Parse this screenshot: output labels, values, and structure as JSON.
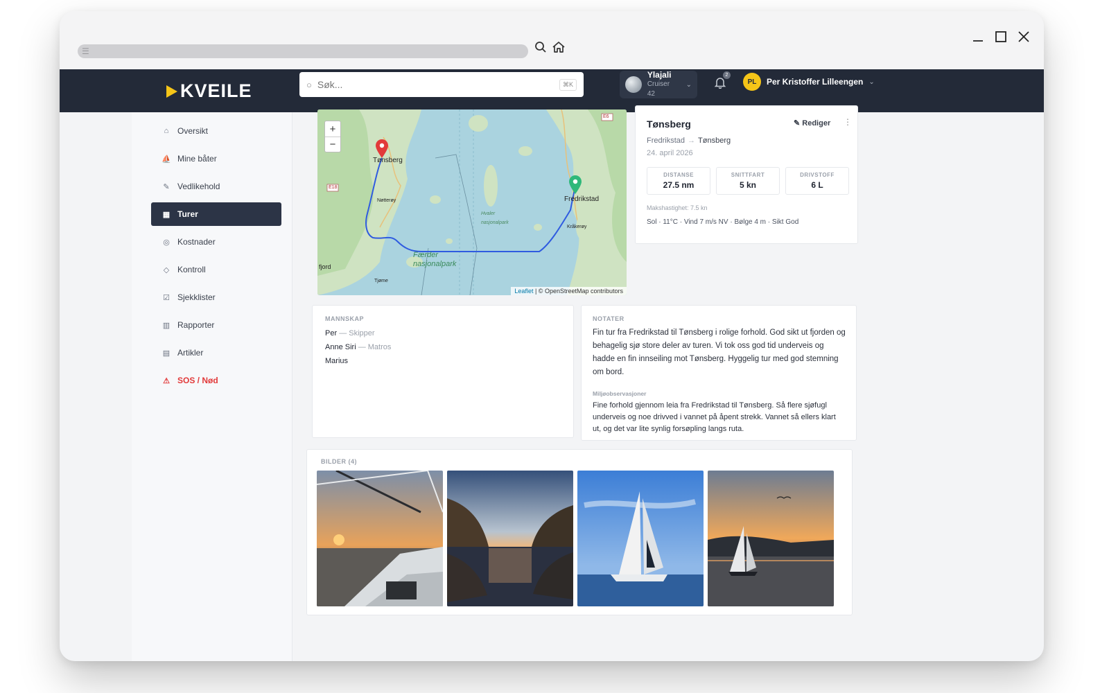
{
  "browser": {
    "window_controls": {
      "minimize_icon": "minimize-icon",
      "maximize_icon": "maximize-icon",
      "close_icon": "close-icon"
    },
    "toolbar_icons": [
      "search-icon",
      "home-icon"
    ]
  },
  "header": {
    "logo_text": "KVEILE",
    "search": {
      "placeholder": "Søk...",
      "shortcut": "⌘K"
    },
    "boat": {
      "name": "Ylajali",
      "model": "Cruiser 42"
    },
    "notifications": {
      "count": "2"
    },
    "user": {
      "initials": "PL",
      "name": "Per Kristoffer Lilleengen"
    }
  },
  "sidebar": {
    "items": [
      {
        "label": "Oversikt",
        "icon": "home-icon",
        "glyph": "⌂"
      },
      {
        "label": "Mine båter",
        "icon": "boat-icon",
        "glyph": "⛵"
      },
      {
        "label": "Vedlikehold",
        "icon": "wrench-icon",
        "glyph": "✎"
      },
      {
        "label": "Turer",
        "icon": "map-icon",
        "glyph": "▦"
      },
      {
        "label": "Kostnader",
        "icon": "coins-icon",
        "glyph": "◎"
      },
      {
        "label": "Kontroll",
        "icon": "shield-icon",
        "glyph": "◇"
      },
      {
        "label": "Sjekklister",
        "icon": "checklist-icon",
        "glyph": "☑"
      },
      {
        "label": "Rapporter",
        "icon": "bar-chart-icon",
        "glyph": "▥"
      },
      {
        "label": "Artikler",
        "icon": "article-icon",
        "glyph": "▤"
      },
      {
        "label": "SOS / Nød",
        "icon": "warning-icon",
        "glyph": "⚠"
      }
    ],
    "active_index": 3
  },
  "map": {
    "zoom_in": "+",
    "zoom_out": "−",
    "places": [
      "Tønsberg",
      "Fredrikstad",
      "Nøtterøy",
      "Kråkerøy",
      "fjord",
      "Tjøme",
      "E18",
      "E6"
    ],
    "park": "Færder nasjonalpark",
    "reserve": "Hvaler nasjonalpark",
    "attribution_link": "Leaflet",
    "attribution_text": "| © OpenStreetMap contributors"
  },
  "trip": {
    "title": "Tønsberg",
    "edit_label": "Rediger",
    "from": "Fredrikstad",
    "to": "Tønsberg",
    "date": "24. april 2026",
    "stats": [
      {
        "label": "DISTANSE",
        "value": "27.5 nm"
      },
      {
        "label": "SNITTFART",
        "value": "5 kn"
      },
      {
        "label": "DRIVSTOFF",
        "value": "6 L"
      }
    ],
    "max_speed": "Makshastighet: 7.5 kn",
    "weather": "Sol · 11°C · Vind 7 m/s NV · Bølge 4 m · Sikt God"
  },
  "crew": {
    "label": "MANNSKAP",
    "members": [
      {
        "name": "Per",
        "role": "— Skipper"
      },
      {
        "name": "Anne Siri",
        "role": "— Matros"
      },
      {
        "name": "Marius",
        "role": ""
      }
    ]
  },
  "notes": {
    "label": "NOTATER",
    "text": "Fin tur fra Fredrikstad til Tønsberg i rolige forhold. God sikt ut fjorden og behagelig sjø store deler av turen. Vi tok oss god tid underveis og hadde en fin innseiling mot Tønsberg. Hyggelig tur med god stemning om bord.",
    "env_label": "Miljøobservasjoner",
    "env_text": "Fine forhold gjennom leia fra Fredrikstad til Tønsberg. Så flere sjøfugl underveis og noe drivved i vannet på åpent strekk. Vannet så ellers klart ut, og det var lite synlig forsøpling langs ruta."
  },
  "photos": {
    "label": "BILDER (4)",
    "items": [
      "sailboat-deck-sunset-photo",
      "fjord-reflection-photo",
      "sailboat-blue-sky-photo",
      "sailboat-sunset-photo"
    ]
  }
}
